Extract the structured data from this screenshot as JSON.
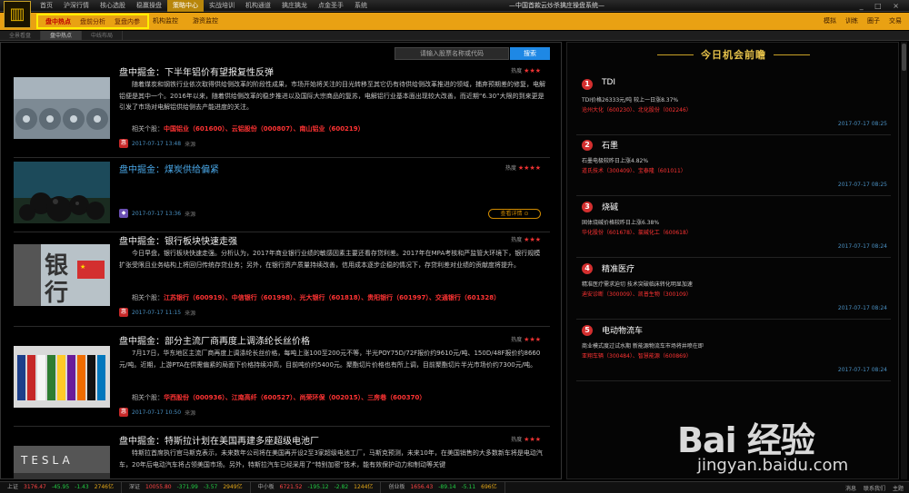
{
  "menubar": {
    "logo": "▥",
    "items": [
      "首页",
      "沪深行情",
      "核心选股",
      "稳赢操盘",
      "策略中心",
      "实战培训",
      "机构通道",
      "擒庄擒龙",
      "点金圣手",
      "系统"
    ],
    "app_title": "—中国首款云炒杀擒庄操盘系统—",
    "window_controls": "_ □ ×"
  },
  "subbar": {
    "tabs": [
      "盘中热点",
      "盘前分析",
      "复盘内参"
    ],
    "other": [
      "机构监控",
      "游资监控"
    ],
    "tools": [
      "模拟",
      "训练",
      "圈子",
      "交易"
    ]
  },
  "tabbar": {
    "tabs": [
      "全景看盘",
      "盘中热点",
      "中线布局"
    ]
  },
  "search": {
    "placeholder": "请输入股票名称或代码",
    "button": "搜索"
  },
  "articles": [
    {
      "title": "盘中掘金：下半年铝价有望报复性反弹",
      "heat_label": "热度",
      "stars": "★★★",
      "body": "随着煤炭和钢铁行业依次取得供给侧改革的阶段性成果，市场开始将关注的目光转移至其它仍有待供给侧改革推进的领域，捕弃预期差的修复，电解铝便是其中一个。2016年以来，随着供给侧改革的稳步推进以及国际大宗商品的复苏，电解铝行业基本面出现较大改善，而近期“6.30”大限的到来更是引发了市场对电解铝供给侧去产能进度的关注。",
      "stocks_label": "相关个股：",
      "stocks": "中国铝业（601600）、云铝股份（000807）、南山铝业（600219）",
      "date": "2017-07-17 13:48",
      "source": "来源"
    },
    {
      "title": "盘中掘金：煤炭供给偏紧",
      "heat_label": "热度",
      "stars": "★★★★",
      "date": "2017-07-17 13:36",
      "source": "来源",
      "detail": "查看详情 ⊙"
    },
    {
      "title": "盘中掘金：银行板块快速走强",
      "heat_label": "热度",
      "stars": "★★★",
      "body": "今日早盘，银行板块快速走强。分析认为，2017年商业银行业绩的敏感因素主要还看存贷利差。2017年在MPA考核和严监管大环境下，银行规模扩张受限且业务结构上将回归传统存贷业务；另外，在银行资产质量持续改善，信用成本逐步企稳的情况下，存贷利差对业绩的贡献度将提升。",
      "stocks_label": "相关个股：",
      "stocks": "江苏银行（600919）、中信银行（601998）、光大银行（601818）、贵阳银行（601997）、交通银行（601328）",
      "date": "2017-07-17 11:15",
      "source": "来源"
    },
    {
      "title": "盘中掘金：部分主流厂商再度上调涤纶长丝价格",
      "heat_label": "热度",
      "stars": "★★★",
      "body": "7月17日，华东地区主流厂商再度上调涤纶长丝价格，每吨上涨100至200元不等，半光POY75D/72F报价约9610元/吨、150D/48F报价约8660元/吨。近期，上游PTA在供需偏紧的局面下价格持续冲高，目前吨价约5400元。聚酯切片价格也有所上调，目前聚酯切片半光市场价约7300元/吨。",
      "stocks_label": "相关个股：",
      "stocks": "华西股份（000936）、江南高纤（600527）、尚荣环保（002015）、三房巷（600370）",
      "date": "2017-07-17 10:50",
      "source": "来源"
    },
    {
      "title": "盘中掘金：特斯拉计划在美国再建多座超级电池厂",
      "heat_label": "热度",
      "stars": "★★★",
      "body": "特斯拉首席执行官马斯克表示，未来数年公司将在美国再开设2至3家超级电池工厂，马斯克预测，未来10年，在美国销售的大多数新车将是电动汽车，20年后电动汽车将占领美国市场。另外，特斯拉汽车已经采用了“特别加密”技术，能有效保护动力和制动等关键"
    }
  ],
  "right_panel": {
    "title": "今日机会前瞻",
    "items": [
      {
        "num": "1",
        "name": "TDI",
        "desc": "TDI价格26333元/吨 较上一日涨8.37%",
        "stocks": "沧州大化（600230）、北化股份（002246）",
        "time": "2017-07-17 08:25"
      },
      {
        "num": "2",
        "name": "石墨",
        "desc": "石墨电极较昨日上涨4.82%",
        "stocks": "道氏技术（300409）、宝泰隆（601011）",
        "time": "2017-07-17 08:25"
      },
      {
        "num": "3",
        "name": "烧碱",
        "desc": "固体烧碱价格较昨日上涨6.38%",
        "stocks": "华化股份（601678）、氯碱化工（600618）",
        "time": "2017-07-17 08:24"
      },
      {
        "num": "4",
        "name": "精准医疗",
        "desc": "精准医疗需求迫切 技术突破临床转化明显加速",
        "stocks": "迪安诊断（300009）、凯普生物（300109）",
        "time": "2017-07-17 08:24"
      },
      {
        "num": "5",
        "name": "电动物流车",
        "desc": "商业模式度过试水期 新能源物流车市场将井喷在即",
        "stocks": "亚翔车辆（300484）、智慧能源（600869）",
        "time": "2017-07-17 08:24"
      }
    ]
  },
  "statusbar": {
    "indices": [
      {
        "name": "上证",
        "value": "3176.47",
        "chg": "-45.95",
        "pct": "-1.43",
        "amt": "2746亿"
      },
      {
        "name": "深证",
        "value": "10055.80",
        "chg": "-371.99",
        "pct": "-3.57",
        "amt": "2949亿"
      },
      {
        "name": "中小板",
        "value": "6721.52",
        "chg": "-195.12",
        "pct": "-2.82",
        "amt": "1244亿"
      },
      {
        "name": "创业板",
        "value": "1656.43",
        "chg": "-89.14",
        "pct": "-5.11",
        "amt": "696亿"
      }
    ],
    "right": [
      "消息",
      "联系我们",
      "主题"
    ]
  },
  "watermark": {
    "text": "Bai 经验",
    "sub": "jingyan.baidu.com"
  },
  "colors": {
    "accent": "#e9a113",
    "up": "#ff3333",
    "down": "#22cc44",
    "link": "#4aa8e8"
  }
}
